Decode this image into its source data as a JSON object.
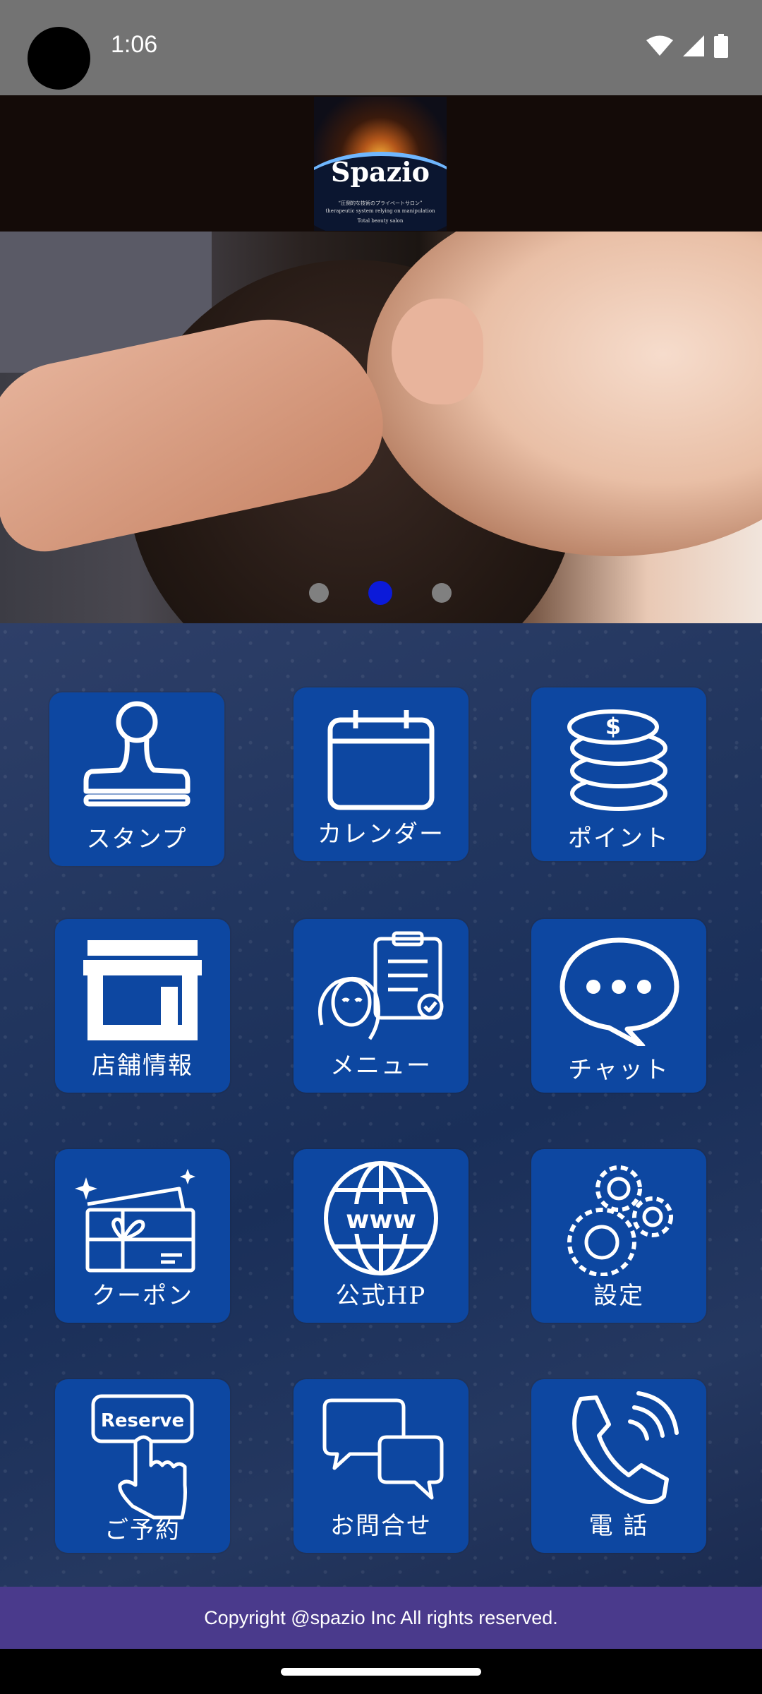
{
  "status_bar": {
    "time": "1:06"
  },
  "header": {
    "logo_name": "Spazio",
    "logo_sub1": "“圧倒的な技術のプライベートサロン”",
    "logo_sub2": "therapeutic system relying on manipulation",
    "logo_sub3": "Total beauty salon"
  },
  "carousel": {
    "slide_count": 3,
    "active_index": 1
  },
  "menu": [
    {
      "label": "スタンプ",
      "icon": "stamp-icon"
    },
    {
      "label": "カレンダー",
      "icon": "calendar-icon"
    },
    {
      "label": "ポイント",
      "icon": "coins-icon"
    },
    {
      "label": "店舗情報",
      "icon": "store-icon"
    },
    {
      "label": "メニュー",
      "icon": "menu-clipboard-icon"
    },
    {
      "label": "チャット",
      "icon": "chat-bubble-icon"
    },
    {
      "label": "クーポン",
      "icon": "gift-card-icon"
    },
    {
      "label": "公式HP",
      "icon": "globe-www-icon"
    },
    {
      "label": "設定",
      "icon": "gears-icon"
    },
    {
      "label": "ご予約",
      "icon": "reserve-hand-icon",
      "badge": "Reserve"
    },
    {
      "label": "お問合せ",
      "icon": "speech-bubbles-icon"
    },
    {
      "label": "電 話",
      "icon": "phone-icon"
    }
  ],
  "footer": {
    "copyright": "Copyright @spazio Inc All rights reserved."
  }
}
